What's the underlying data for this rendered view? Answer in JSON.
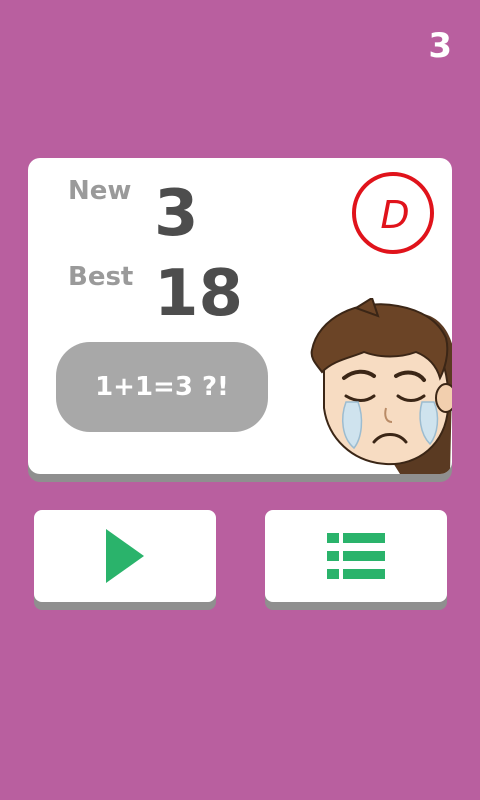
{
  "hud": {
    "score": "3"
  },
  "result": {
    "new_label": "New",
    "new_score": "3",
    "best_label": "Best",
    "best_score": "18",
    "grade": "D",
    "bubble_text": "1+1=3 ?!"
  },
  "buttons": {
    "play_icon": "play-icon",
    "menu_icon": "list-icon"
  },
  "colors": {
    "background": "#b95f9f",
    "accent_green": "#2ab36b",
    "grade_red": "#e0131b",
    "bubble_gray": "#a8a8a8"
  }
}
